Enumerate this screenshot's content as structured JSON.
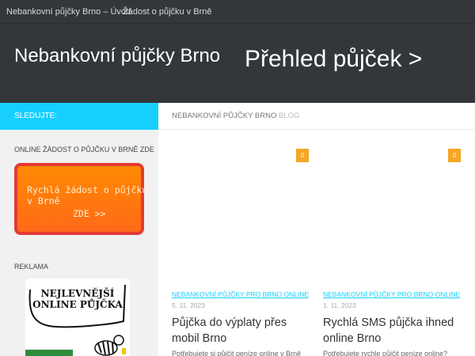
{
  "top_nav": {
    "home": "Nebankovní půjčky Brno – Úvod",
    "request": "Žádost o půjčku v Brně"
  },
  "header": {
    "site_title": "Nebankovní půjčky Brno",
    "overview_link": "Přehled půjček >"
  },
  "sidebar": {
    "follow_label": "SLEDUJTE:",
    "online_heading": "ONLINE ŽÁDOST O PŮJČKU V BRNĚ ZDE",
    "orange_banner": {
      "line1": "Rychlá žádost o půjčku",
      "line1b": "v Brně",
      "line2": "ZDE >>"
    },
    "ads_heading": "REKLAMA",
    "ad_banner": {
      "line1": "NEJLEVNĚJŠÍ",
      "line2": "ONLINE PŮJČKA"
    }
  },
  "breadcrumb": {
    "site": "NEBANKOVNÍ PŮJČKY BRNO",
    "section": "BLOG"
  },
  "posts": [
    {
      "comments": "0",
      "category": "NEBANKOVNÍ PŮJČKY PRO BRNO ONLINE",
      "date": "5. 11. 2023",
      "title": "Půjčka do výplaty přes mobil Brno",
      "excerpt": "Potřebujete si půjčit peníze online v Brně"
    },
    {
      "comments": "0",
      "category": "NEBANKOVNÍ PŮJČKY PRO BRNO ONLINE",
      "date": "1. 11. 2023",
      "title": "Rychlá SMS půjčka ihned online Brno",
      "excerpt": "Potřebujete rychle půjčit peníze online?"
    }
  ],
  "colors": {
    "header_bg": "#33363b",
    "accent_cyan": "#16cfff",
    "badge_orange": "#f5a623",
    "banner_red": "#e53935",
    "banner_orange": "#ff7a10"
  }
}
